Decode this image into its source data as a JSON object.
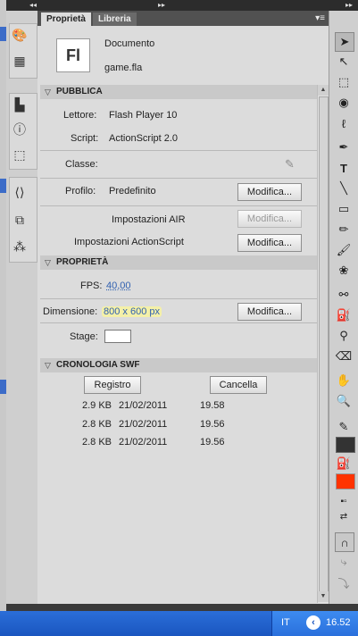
{
  "tabs": {
    "properties": "Proprietà",
    "library": "Libreria"
  },
  "document": {
    "label": "Documento",
    "icon_text": "Fl",
    "filename": "game.fla"
  },
  "publish": {
    "section": "PUBBLICA",
    "player_label": "Lettore:",
    "player_value": "Flash Player 10",
    "script_label": "Script:",
    "script_value": "ActionScript 2.0",
    "class_label": "Classe:",
    "profile_label": "Profilo:",
    "profile_value": "Predefinito",
    "modify": "Modifica...",
    "air_label": "Impostazioni AIR",
    "as_label": "Impostazioni ActionScript"
  },
  "properties": {
    "section": "PROPRIETÀ",
    "fps_label": "FPS:",
    "fps_value": "40,00",
    "size_label": "Dimensione:",
    "size_value": "800 x 600 px",
    "stage_label": "Stage:",
    "stage_color": "#ffffff"
  },
  "history": {
    "section": "CRONOLOGIA SWF",
    "log_button": "Registro",
    "clear_button": "Cancella",
    "rows": [
      {
        "size": "2.9 KB",
        "date": "21/02/2011",
        "time": "19.58"
      },
      {
        "size": "2.8 KB",
        "date": "21/02/2011",
        "time": "19.56"
      },
      {
        "size": "2.8 KB",
        "date": "21/02/2011",
        "time": "19.56"
      }
    ]
  },
  "taskbar": {
    "lang": "IT",
    "clock": "16.52"
  },
  "colors": {
    "fill": "#ff3300",
    "stroke": "#333333"
  }
}
